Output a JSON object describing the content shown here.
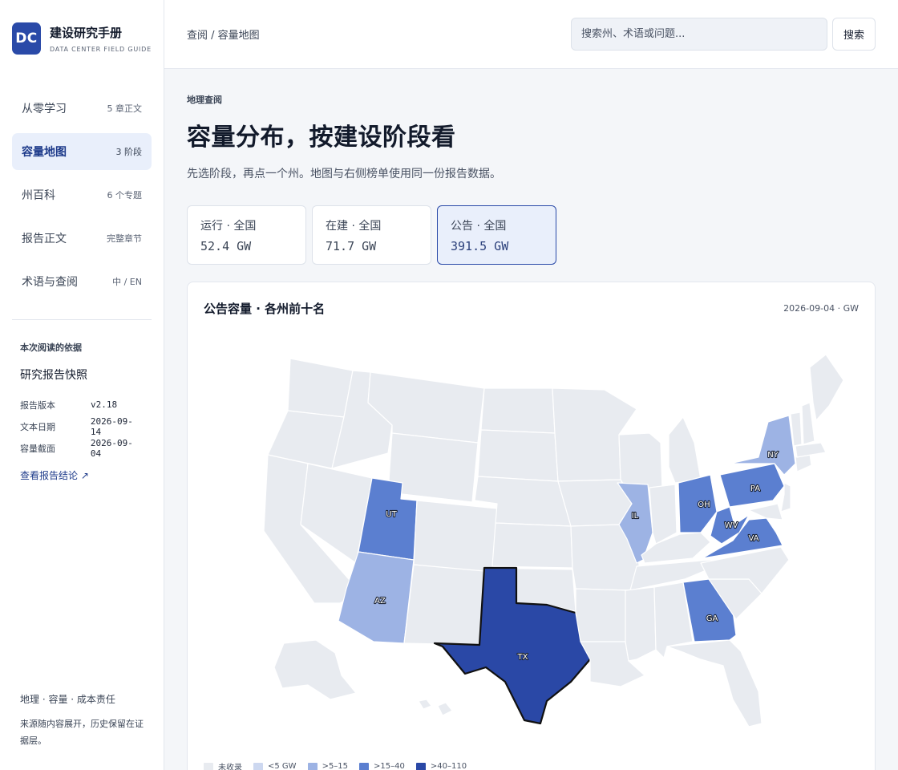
{
  "brand": {
    "logo": "DC",
    "title": "建设研究手册",
    "subtitle": "DATA CENTER FIELD GUIDE"
  },
  "nav": [
    {
      "label": "从零学习",
      "meta": "5 章正文",
      "active": false
    },
    {
      "label": "容量地图",
      "meta": "3 阶段",
      "active": true
    },
    {
      "label": "州百科",
      "meta": "6 个专题",
      "active": false
    },
    {
      "label": "报告正文",
      "meta": "完整章节",
      "active": false
    },
    {
      "label": "术语与查阅",
      "meta": "中 / EN",
      "active": false
    }
  ],
  "basis": {
    "kicker": "本次阅读的依据",
    "title": "研究报告快照",
    "rows": [
      {
        "k": "报告版本",
        "v": "v2.18"
      },
      {
        "k": "文本日期",
        "v": "2026-09-14"
      },
      {
        "k": "容量截面",
        "v": "2026-09-04"
      }
    ],
    "link": "查看报告结论 ↗"
  },
  "footer": {
    "line1": "地理 · 容量 · 成本责任",
    "line2": "来源随内容展开，历史保留在证据层。"
  },
  "topbar": {
    "breadcrumb": "查阅 / 容量地图",
    "search_placeholder": "搜索州、术语或问题...",
    "search_button": "搜索"
  },
  "page": {
    "kicker": "地理查阅",
    "title": "容量分布，按建设阶段看",
    "lead": "先选阶段，再点一个州。地图与右侧榜单使用同一份报告数据。"
  },
  "stages": [
    {
      "label": "运行 · 全国",
      "value": "52.4 GW",
      "active": false
    },
    {
      "label": "在建 · 全国",
      "value": "71.7 GW",
      "active": false
    },
    {
      "label": "公告 · 全国",
      "value": "391.5 GW",
      "active": true
    }
  ],
  "map": {
    "title": "公告容量 · 各州前十名",
    "meta": "2026-09-04 · GW",
    "highlighted": [
      "TX",
      "UT",
      "AZ",
      "IL",
      "OH",
      "PA",
      "NY",
      "WV",
      "VA",
      "GA"
    ],
    "colors": {
      "none": "#e8ebf0",
      "lt5": "#cdd8f0",
      "b5_15": "#9db3e4",
      "b15_40": "#5b7fd0",
      "b40_110": "#2a48a6",
      "border": "#ffffff",
      "selected_outline": "#111111"
    },
    "legend": [
      {
        "label": "未收录",
        "color": "#e8ebf0"
      },
      {
        "label": "<5 GW",
        "color": "#cdd8f0"
      },
      {
        "label": ">5–15",
        "color": "#9db3e4"
      },
      {
        "label": ">15–40",
        "color": "#5b7fd0"
      },
      {
        "label": ">40–110",
        "color": "#2a48a6"
      }
    ]
  }
}
